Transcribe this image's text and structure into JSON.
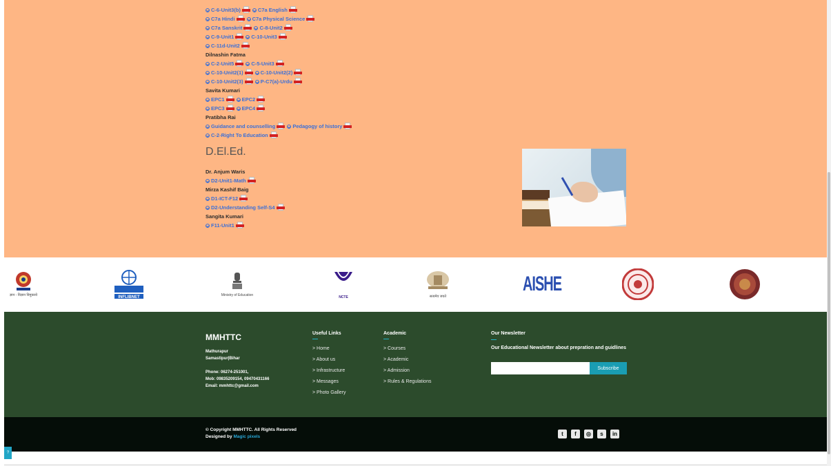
{
  "faculty_blocks": [
    {
      "person": null,
      "rows": [
        [
          "C-6-Unit3(b)",
          "C7a English"
        ],
        [
          "C7a Hindi",
          "C7a Physical Science"
        ],
        [
          "C7a Sanskrit",
          "C-8-Unit2"
        ],
        [
          "C-9-Unit1",
          "C-10-Unit3"
        ],
        [
          "C-11d-Unit2"
        ]
      ]
    },
    {
      "person": "Dilnashin Fatma",
      "rows": [
        [
          "C-2-Unit5",
          "C-5-Unit3"
        ],
        [
          "C-10-Unit2(1)",
          "C-10-Unit2(2)"
        ],
        [
          "C-10-Unit2(3)",
          "P-C7(a)-Urdu"
        ]
      ]
    },
    {
      "person": "Savita Kumari",
      "rows": [
        [
          "EPC1",
          "EPC2"
        ],
        [
          "EPC3",
          "EPC4"
        ]
      ]
    },
    {
      "person": "Pratibha Rai",
      "rows": [
        [
          "Guidance and counselling",
          "Pedagogy of history"
        ],
        [
          "C-2-Right To Education"
        ]
      ]
    }
  ],
  "section_heading": "D.El.Ed.",
  "deled_blocks": [
    {
      "person": "Dr. Anjum Waris",
      "rows": [
        [
          "D2-Unit1-Math"
        ]
      ]
    },
    {
      "person": "Mirza Kashif Baig",
      "rows": [
        [
          "D1-ICT-F12"
        ],
        [
          "D2-Understanding Self-S4"
        ]
      ]
    },
    {
      "person": "Sangita Kumari",
      "rows": [
        [
          "F11-Unit1"
        ]
      ]
    }
  ],
  "logos": [
    {
      "name": "ugc-logo",
      "caption": "ज्ञान - विज्ञान विमुक्तये"
    },
    {
      "name": "inflibnet-logo",
      "caption": "INFLIBNET"
    },
    {
      "name": "ministry-of-education-logo",
      "caption": "Ministry of Education"
    },
    {
      "name": "ncte-logo",
      "caption": "NCTE"
    },
    {
      "name": "emblem-logo",
      "caption": "सत्यमेव जयते"
    },
    {
      "name": "aishe-logo",
      "caption": "AISHE"
    },
    {
      "name": "university-seal-logo",
      "caption": ""
    },
    {
      "name": "bihar-seal-logo",
      "caption": ""
    }
  ],
  "footer": {
    "brand": "MMHTTC",
    "address_line1": "Mathurapur",
    "address_line2": "Samastipur|Bihar",
    "phone": "Phone: 06274-251001,",
    "mob": "Mob: 09835209154, 09470431166",
    "email": "Email: mmhttc@gmail.com",
    "useful_links_title": "Useful Links",
    "useful_links": [
      "> Home",
      "> About us",
      "> Infrastructure",
      "> Messages",
      "> Photo Gallery"
    ],
    "academic_title": "Academic",
    "academic_links": [
      "> Courses",
      "> Academic",
      "> Admission",
      "> Rules & Regulations"
    ],
    "newsletter_title": "Our Newsletter",
    "newsletter_desc": "Our Educational Newsletter about prepration and guidlines",
    "subscribe_label": "Subscribe"
  },
  "bottom": {
    "copyright": "© Copyright MMHTTC. All Rights Reserved",
    "designed_by_prefix": "Designed by ",
    "designed_by_name": "Magic pixels",
    "social": [
      {
        "icon": "twitter-icon",
        "glyph": "t"
      },
      {
        "icon": "facebook-icon",
        "glyph": "f"
      },
      {
        "icon": "instagram-icon",
        "glyph": "◎"
      },
      {
        "icon": "skype-icon",
        "glyph": "s"
      },
      {
        "icon": "linkedin-icon",
        "glyph": "in"
      }
    ]
  },
  "help_button_label": "?",
  "colors": {
    "content_bg": "#feb684",
    "footer_bg": "#2c4b2c",
    "bottom_bg": "#050d08",
    "link": "#3a6fd8",
    "accent": "#1a9db3"
  }
}
